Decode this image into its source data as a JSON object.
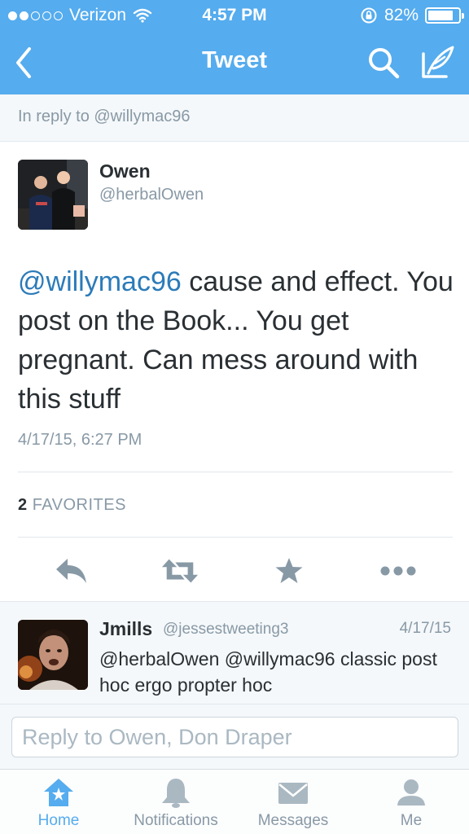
{
  "status_bar": {
    "carrier": "Verizon",
    "time": "4:57 PM",
    "battery": "82%",
    "battery_level": 0.82,
    "signal_bars_filled": 2,
    "signal_bars_total": 5
  },
  "nav": {
    "title": "Tweet",
    "back_icon": "chevron-left-icon",
    "search_icon": "search-icon",
    "compose_icon": "compose-tweet-icon"
  },
  "in_reply_to": "In reply to @willymac96",
  "tweet": {
    "name": "Owen",
    "handle": "@herbalOwen",
    "mention": "@willymac96",
    "text": " cause and effect. You post on the Book... You get pregnant. Can mess around with this stuff",
    "date": "4/17/15, 6:27 PM",
    "favorites_count": "2",
    "favorites_label": "FAVORITES"
  },
  "actions": {
    "reply_icon": "reply-icon",
    "retweet_icon": "retweet-icon",
    "favorite_icon": "star-icon",
    "more_icon": "more-dots-icon"
  },
  "replies": [
    {
      "name": "Jmills",
      "handle": "@jessestweeting3",
      "date": "4/17/15",
      "text": "@herbalOwen @willymac96 classic post hoc ergo propter hoc"
    }
  ],
  "composer": {
    "placeholder": "Reply to Owen, Don Draper"
  },
  "tabs": [
    {
      "label": "Home",
      "icon": "home-icon",
      "active": true
    },
    {
      "label": "Notifications",
      "icon": "bell-icon",
      "active": false
    },
    {
      "label": "Messages",
      "icon": "envelope-icon",
      "active": false
    },
    {
      "label": "Me",
      "icon": "person-icon",
      "active": false
    }
  ],
  "colors": {
    "brand": "#55acee",
    "link": "#2b7bb9",
    "muted": "#8899a6",
    "inactive_icon": "#aab8c2"
  }
}
